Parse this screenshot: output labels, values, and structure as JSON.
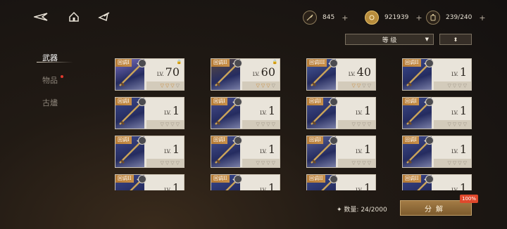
{
  "topbar": {
    "back_icon": "back-arrow-icon",
    "home_icon": "home-icon",
    "share_icon": "share-icon",
    "resources": [
      {
        "icon": "stamina-feather-icon",
        "value": "845",
        "plus": "+"
      },
      {
        "icon": "gold-coin-icon",
        "value": "921939",
        "plus": "+"
      },
      {
        "icon": "capacity-lantern-icon",
        "value": "239/240",
        "plus": "+"
      }
    ]
  },
  "filter": {
    "label": "等 级",
    "arrow": "▼"
  },
  "sort": {
    "label": "⬍"
  },
  "sidebar": {
    "items": [
      {
        "label": "武器"
      },
      {
        "label": "物品"
      },
      {
        "label": "古燼"
      }
    ]
  },
  "cards": [
    {
      "tag": "回调I",
      "lv": "LV.",
      "level": "70",
      "stars_on": 3,
      "locked": true,
      "art": "#7a6fc0"
    },
    {
      "tag": "回调II",
      "lv": "LV.",
      "level": "60",
      "stars_on": 3,
      "locked": true,
      "art": "#5a4a40"
    },
    {
      "tag": "回调III",
      "lv": "LV.",
      "level": "40",
      "stars_on": 2,
      "locked": false,
      "art": "#4a5fa0"
    },
    {
      "tag": "回调II",
      "lv": "LV.",
      "level": "1",
      "stars_on": 0,
      "locked": false,
      "art": "#3a4a90"
    },
    {
      "tag": "回调I",
      "lv": "LV.",
      "level": "1",
      "stars_on": 0,
      "locked": false,
      "art": "#3d4a8c"
    },
    {
      "tag": "回调I",
      "lv": "LV.",
      "level": "1",
      "stars_on": 0,
      "locked": false,
      "art": "#4a5090"
    },
    {
      "tag": "回调I",
      "lv": "LV.",
      "level": "1",
      "stars_on": 0,
      "locked": false,
      "art": "#44508e"
    },
    {
      "tag": "回调I",
      "lv": "LV.",
      "level": "1",
      "stars_on": 0,
      "locked": false,
      "art": "#3f4c8a"
    },
    {
      "tag": "回调I",
      "lv": "LV.",
      "level": "1",
      "stars_on": 0,
      "locked": false,
      "art": "#3f4a8c"
    },
    {
      "tag": "回调I",
      "lv": "LV.",
      "level": "1",
      "stars_on": 0,
      "locked": false,
      "art": "#485492"
    },
    {
      "tag": "回调I",
      "lv": "LV.",
      "level": "1",
      "stars_on": 0,
      "locked": false,
      "art": "#5a6296"
    },
    {
      "tag": "回调I",
      "lv": "LV.",
      "level": "1",
      "stars_on": 0,
      "locked": false,
      "art": "#404c8c"
    },
    {
      "tag": "回调II",
      "lv": "LV.",
      "level": "1",
      "stars_on": 0,
      "locked": false,
      "art": "#3a4688"
    },
    {
      "tag": "回调II",
      "lv": "LV.",
      "level": "1",
      "stars_on": 0,
      "locked": false,
      "art": "#3a4a8e"
    },
    {
      "tag": "回调II",
      "lv": "LV.",
      "level": "1",
      "stars_on": 0,
      "locked": false,
      "art": "#3b4a8a"
    },
    {
      "tag": "回调II",
      "lv": "LV.",
      "level": "1",
      "stars_on": 0,
      "locked": false,
      "art": "#3a4688"
    }
  ],
  "footer": {
    "count_icon": "✦",
    "count_label": "数量: 24/2000",
    "decompose_label": "分解",
    "percent": "100%"
  }
}
